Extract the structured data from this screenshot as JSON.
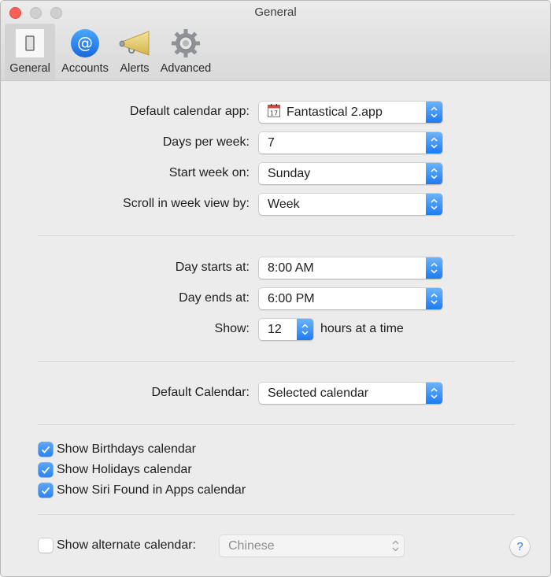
{
  "window": {
    "title": "General"
  },
  "toolbar": {
    "items": [
      {
        "label": "General",
        "icon": "switch-icon",
        "selected": true
      },
      {
        "label": "Accounts",
        "icon": "at-sign-icon",
        "selected": false
      },
      {
        "label": "Alerts",
        "icon": "megaphone-icon",
        "selected": false
      },
      {
        "label": "Advanced",
        "icon": "gear-icon",
        "selected": false
      }
    ]
  },
  "section1": {
    "default_app": {
      "label": "Default calendar app:",
      "value": "Fantastical 2.app",
      "icon": "calendar-app-icon",
      "icon_day": "17"
    },
    "days_per_week": {
      "label": "Days per week:",
      "value": "7"
    },
    "start_week": {
      "label": "Start week on:",
      "value": "Sunday"
    },
    "scroll_by": {
      "label": "Scroll in week view by:",
      "value": "Week"
    }
  },
  "section2": {
    "day_starts": {
      "label": "Day starts at:",
      "value": "8:00 AM"
    },
    "day_ends": {
      "label": "Day ends at:",
      "value": "6:00 PM"
    },
    "show": {
      "label": "Show:",
      "value": "12",
      "suffix": "hours at a time"
    }
  },
  "section3": {
    "default_calendar": {
      "label": "Default Calendar:",
      "value": "Selected calendar"
    }
  },
  "section4": {
    "checkboxes": [
      {
        "label": "Show Birthdays calendar",
        "checked": true
      },
      {
        "label": "Show Holidays calendar",
        "checked": true
      },
      {
        "label": "Show Siri Found in Apps calendar",
        "checked": true
      }
    ]
  },
  "section5": {
    "alternate": {
      "label": "Show alternate calendar:",
      "checked": false,
      "value": "Chinese",
      "enabled": false
    }
  },
  "help": {
    "label": "?"
  },
  "colors": {
    "accent": "#2c84f0",
    "close": "#fc5f57",
    "background": "#ececec"
  }
}
